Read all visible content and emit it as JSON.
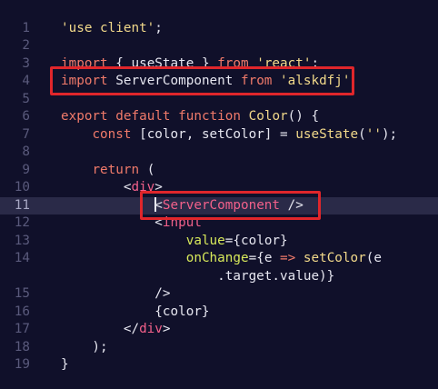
{
  "editor": {
    "active_line": 11,
    "lines": [
      {
        "num": "1",
        "tokens": [
          {
            "t": "'use client'",
            "c": "str"
          },
          {
            "t": ";",
            "c": "punct"
          }
        ]
      },
      {
        "num": "2",
        "tokens": []
      },
      {
        "num": "3",
        "tokens": [
          {
            "t": "import",
            "c": "kw"
          },
          {
            "t": " { useState } ",
            "c": "plain"
          },
          {
            "t": "from",
            "c": "kw"
          },
          {
            "t": " ",
            "c": "plain"
          },
          {
            "t": "'react'",
            "c": "str"
          },
          {
            "t": ";",
            "c": "punct"
          }
        ]
      },
      {
        "num": "4",
        "tokens": [
          {
            "t": "import",
            "c": "kw"
          },
          {
            "t": " ServerComponent ",
            "c": "plain"
          },
          {
            "t": "from",
            "c": "kw"
          },
          {
            "t": " ",
            "c": "plain"
          },
          {
            "t": "'alskdfj'",
            "c": "str"
          }
        ]
      },
      {
        "num": "5",
        "tokens": []
      },
      {
        "num": "6",
        "tokens": [
          {
            "t": "export",
            "c": "kw"
          },
          {
            "t": " ",
            "c": "plain"
          },
          {
            "t": "default",
            "c": "kw"
          },
          {
            "t": " ",
            "c": "plain"
          },
          {
            "t": "function",
            "c": "kw"
          },
          {
            "t": " ",
            "c": "plain"
          },
          {
            "t": "Color",
            "c": "fn"
          },
          {
            "t": "() {",
            "c": "punct"
          }
        ]
      },
      {
        "num": "7",
        "tokens": [
          {
            "t": "    ",
            "c": "plain"
          },
          {
            "t": "const",
            "c": "kw"
          },
          {
            "t": " [color, setColor] = ",
            "c": "plain"
          },
          {
            "t": "useState",
            "c": "fn"
          },
          {
            "t": "(",
            "c": "punct"
          },
          {
            "t": "''",
            "c": "str"
          },
          {
            "t": ");",
            "c": "punct"
          }
        ]
      },
      {
        "num": "8",
        "tokens": []
      },
      {
        "num": "9",
        "tokens": [
          {
            "t": "    ",
            "c": "plain"
          },
          {
            "t": "return",
            "c": "kw"
          },
          {
            "t": " (",
            "c": "punct"
          }
        ]
      },
      {
        "num": "10",
        "tokens": [
          {
            "t": "        <",
            "c": "punct"
          },
          {
            "t": "div",
            "c": "tag"
          },
          {
            "t": ">",
            "c": "punct"
          }
        ]
      },
      {
        "num": "11",
        "tokens": [
          {
            "t": "            ",
            "c": "plain"
          },
          {
            "t": "",
            "c": "caret"
          },
          {
            "t": "<",
            "c": "punct"
          },
          {
            "t": "ServerComponent",
            "c": "tag"
          },
          {
            "t": " />",
            "c": "punct"
          }
        ]
      },
      {
        "num": "12",
        "tokens": [
          {
            "t": "            <",
            "c": "punct"
          },
          {
            "t": "input",
            "c": "tag"
          }
        ]
      },
      {
        "num": "13",
        "tokens": [
          {
            "t": "                ",
            "c": "plain"
          },
          {
            "t": "value",
            "c": "attr"
          },
          {
            "t": "={color}",
            "c": "punct"
          }
        ]
      },
      {
        "num": "14",
        "tokens": [
          {
            "t": "                ",
            "c": "plain"
          },
          {
            "t": "onChange",
            "c": "attr"
          },
          {
            "t": "={",
            "c": "punct"
          },
          {
            "t": "e",
            "c": "plain"
          },
          {
            "t": " => ",
            "c": "kw"
          },
          {
            "t": "setColor",
            "c": "fn"
          },
          {
            "t": "(e",
            "c": "punct"
          }
        ]
      },
      {
        "num": "",
        "tokens": [
          {
            "t": "                    .target.value)}",
            "c": "punct"
          }
        ]
      },
      {
        "num": "15",
        "tokens": [
          {
            "t": "            />",
            "c": "punct"
          }
        ]
      },
      {
        "num": "16",
        "tokens": [
          {
            "t": "            {color}",
            "c": "punct"
          }
        ]
      },
      {
        "num": "17",
        "tokens": [
          {
            "t": "        </",
            "c": "punct"
          },
          {
            "t": "div",
            "c": "tag"
          },
          {
            "t": ">",
            "c": "punct"
          }
        ]
      },
      {
        "num": "18",
        "tokens": [
          {
            "t": "    );",
            "c": "punct"
          }
        ]
      },
      {
        "num": "19",
        "tokens": [
          {
            "t": "}",
            "c": "punct"
          }
        ]
      }
    ]
  },
  "annotations": {
    "box_color": "#e0262b",
    "boxed_lines": [
      "4",
      "11"
    ]
  }
}
